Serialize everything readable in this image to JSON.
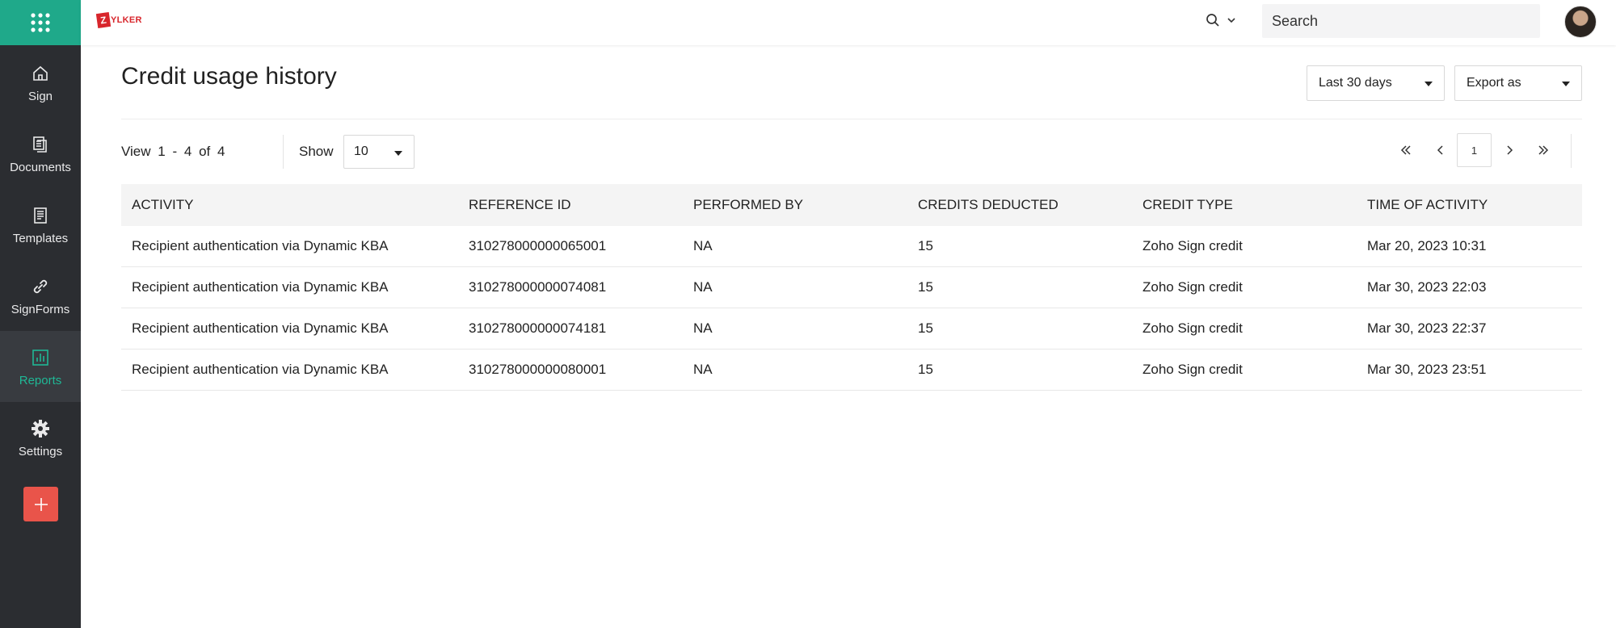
{
  "brand": {
    "logo_letter": "Z",
    "logo_text": "YLKER"
  },
  "topbar": {
    "search_placeholder": "Search"
  },
  "sidebar": {
    "items": [
      {
        "label": "Sign",
        "icon": "home-icon"
      },
      {
        "label": "Documents",
        "icon": "documents-icon"
      },
      {
        "label": "Templates",
        "icon": "templates-icon"
      },
      {
        "label": "SignForms",
        "icon": "link-icon"
      },
      {
        "label": "Reports",
        "icon": "reports-icon",
        "active": true
      },
      {
        "label": "Settings",
        "icon": "gear-icon"
      }
    ],
    "add_label": "+"
  },
  "page": {
    "title": "Credit usage history",
    "date_range": "Last 30 days",
    "export_label": "Export as"
  },
  "listing": {
    "view_label": "View",
    "range_start": "1",
    "range_sep": "-",
    "range_end": "4",
    "of_label": "of",
    "total": "4",
    "show_label": "Show",
    "page_size": "10",
    "current_page": "1"
  },
  "table": {
    "columns": [
      "ACTIVITY",
      "REFERENCE ID",
      "PERFORMED BY",
      "CREDITS DEDUCTED",
      "CREDIT TYPE",
      "TIME OF ACTIVITY"
    ],
    "rows": [
      [
        "Recipient authentication via Dynamic KBA",
        "310278000000065001",
        "NA",
        "15",
        "Zoho Sign credit",
        "Mar 20, 2023 10:31"
      ],
      [
        "Recipient authentication via Dynamic KBA",
        "310278000000074081",
        "NA",
        "15",
        "Zoho Sign credit",
        "Mar 30, 2023 22:03"
      ],
      [
        "Recipient authentication via Dynamic KBA",
        "310278000000074181",
        "NA",
        "15",
        "Zoho Sign credit",
        "Mar 30, 2023 22:37"
      ],
      [
        "Recipient authentication via Dynamic KBA",
        "310278000000080001",
        "NA",
        "15",
        "Zoho Sign credit",
        "Mar 30, 2023 23:51"
      ]
    ]
  },
  "colors": {
    "accent": "#1fa98a",
    "active_text": "#1fb896",
    "sidebar_bg": "#2b2d31",
    "add_button": "#e9544a",
    "brand_red": "#d8262c"
  }
}
